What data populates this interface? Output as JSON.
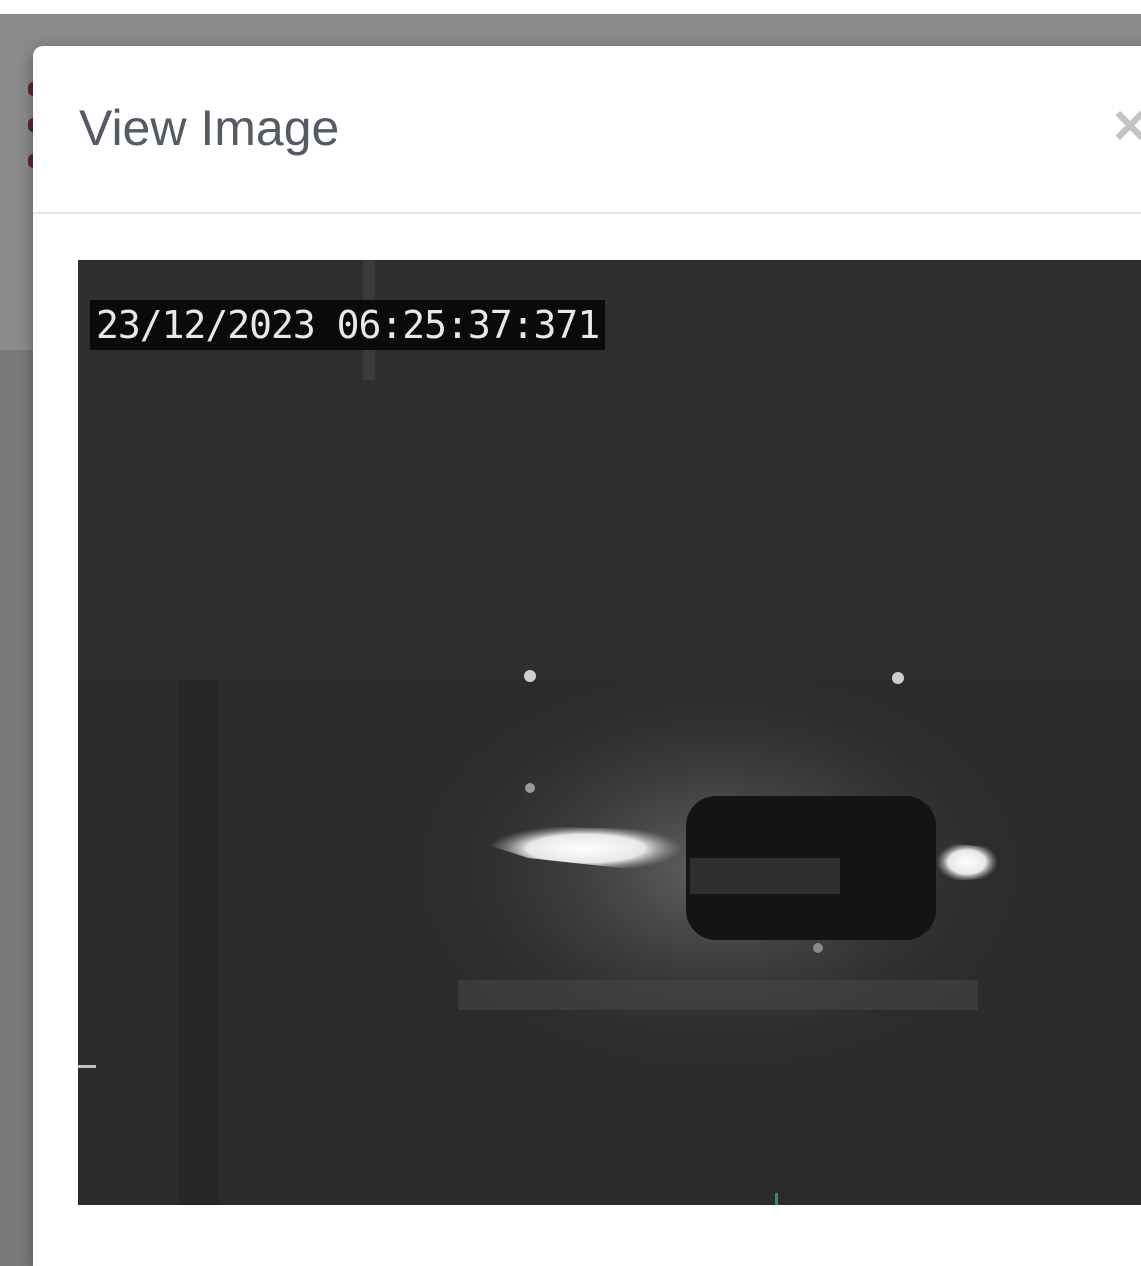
{
  "modal": {
    "title": "View Image",
    "close_glyph": "×"
  },
  "image": {
    "timestamp_overlay": "23/12/2023 06:25:37:371"
  }
}
